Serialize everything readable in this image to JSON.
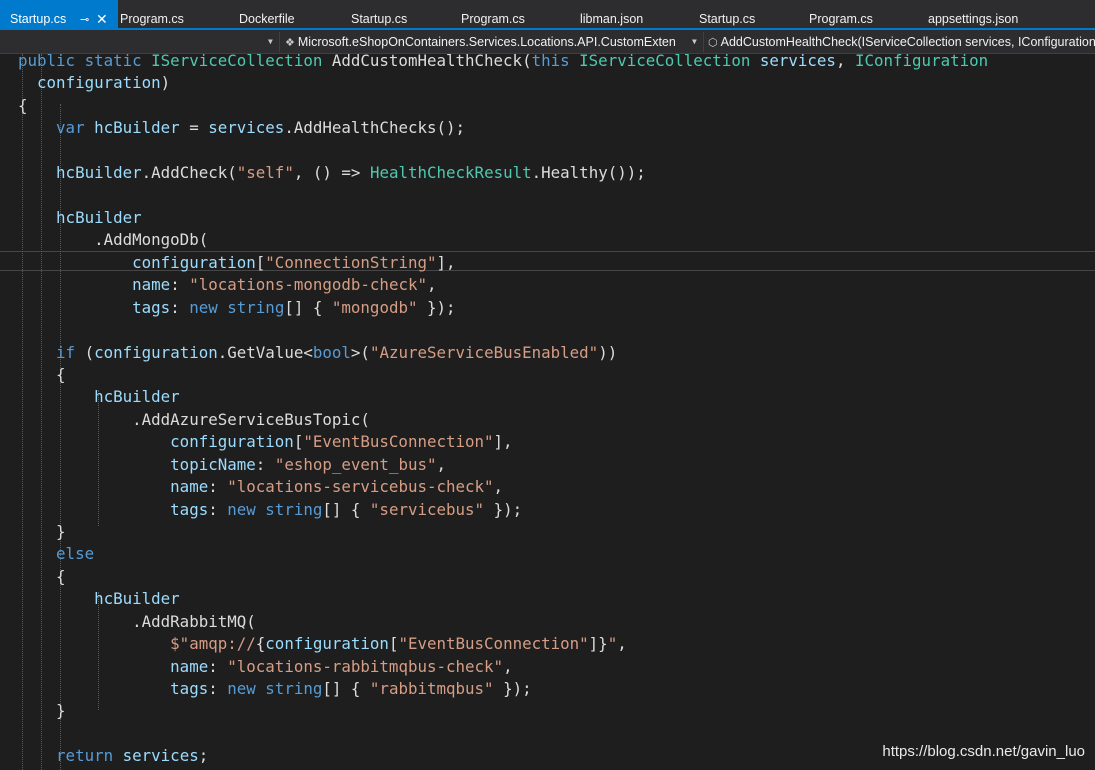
{
  "tabs": [
    {
      "label": "Startup.cs",
      "active": true
    },
    {
      "label": "Program.cs"
    },
    {
      "label": "Dockerfile"
    },
    {
      "label": "Startup.cs"
    },
    {
      "label": "Program.cs"
    },
    {
      "label": "libman.json"
    },
    {
      "label": "Startup.cs"
    },
    {
      "label": "Program.cs"
    },
    {
      "label": "appsettings.json"
    }
  ],
  "tab_icons": {
    "pin": "pin-icon",
    "close": "close-icon"
  },
  "navbar": {
    "type_selector": "Microsoft.eShopOnContainers.Services.Locations.API.CustomExten",
    "member_selector": "AddCustomHealthCheck(IServiceCollection services, IConfiguration"
  },
  "code": [
    [
      [
        "kw",
        "public static "
      ],
      [
        "ty",
        "IServiceCollection "
      ],
      [
        "pl",
        "AddCustomHealthCheck("
      ],
      [
        "kw",
        "this "
      ],
      [
        "ty",
        "IServiceCollection "
      ],
      [
        "id",
        "services"
      ],
      [
        "pl",
        ", "
      ],
      [
        "ty",
        "IConfiguration"
      ]
    ],
    [
      [
        "pl",
        "  "
      ],
      [
        "id",
        "configuration"
      ],
      [
        "pl",
        ")"
      ]
    ],
    [
      [
        "pl",
        "{"
      ]
    ],
    [
      [
        "pl",
        "    "
      ],
      [
        "kw",
        "var "
      ],
      [
        "id",
        "hcBuilder "
      ],
      [
        "pl",
        "= "
      ],
      [
        "id",
        "services"
      ],
      [
        "pl",
        ".AddHealthChecks();"
      ]
    ],
    [
      [
        "pl",
        ""
      ]
    ],
    [
      [
        "pl",
        "    "
      ],
      [
        "id",
        "hcBuilder"
      ],
      [
        "pl",
        ".AddCheck("
      ],
      [
        "str",
        "\"self\""
      ],
      [
        "pl",
        ", () => "
      ],
      [
        "ty",
        "HealthCheckResult"
      ],
      [
        "pl",
        ".Healthy());"
      ]
    ],
    [
      [
        "pl",
        ""
      ]
    ],
    [
      [
        "pl",
        "    "
      ],
      [
        "id",
        "hcBuilder"
      ]
    ],
    [
      [
        "pl",
        "        .AddMongoDb("
      ]
    ],
    [
      [
        "pl",
        "            "
      ],
      [
        "id",
        "configuration"
      ],
      [
        "pl",
        "["
      ],
      [
        "str",
        "\"ConnectionString\""
      ],
      [
        "pl",
        "],"
      ]
    ],
    [
      [
        "pl",
        "            "
      ],
      [
        "id",
        "name"
      ],
      [
        "pl",
        ": "
      ],
      [
        "str",
        "\"locations-mongodb-check\""
      ],
      [
        "pl",
        ","
      ]
    ],
    [
      [
        "pl",
        "            "
      ],
      [
        "id",
        "tags"
      ],
      [
        "pl",
        ": "
      ],
      [
        "kw",
        "new string"
      ],
      [
        "pl",
        "[] { "
      ],
      [
        "str",
        "\"mongodb\""
      ],
      [
        "pl",
        " });"
      ]
    ],
    [
      [
        "pl",
        ""
      ]
    ],
    [
      [
        "pl",
        "    "
      ],
      [
        "kw",
        "if "
      ],
      [
        "pl",
        "("
      ],
      [
        "id",
        "configuration"
      ],
      [
        "pl",
        ".GetValue<"
      ],
      [
        "kw",
        "bool"
      ],
      [
        "pl",
        ">("
      ],
      [
        "str",
        "\"AzureServiceBusEnabled\""
      ],
      [
        "pl",
        "))"
      ]
    ],
    [
      [
        "pl",
        "    {"
      ]
    ],
    [
      [
        "pl",
        "        "
      ],
      [
        "id",
        "hcBuilder"
      ]
    ],
    [
      [
        "pl",
        "            .AddAzureServiceBusTopic("
      ]
    ],
    [
      [
        "pl",
        "                "
      ],
      [
        "id",
        "configuration"
      ],
      [
        "pl",
        "["
      ],
      [
        "str",
        "\"EventBusConnection\""
      ],
      [
        "pl",
        "],"
      ]
    ],
    [
      [
        "pl",
        "                "
      ],
      [
        "id",
        "topicName"
      ],
      [
        "pl",
        ": "
      ],
      [
        "str",
        "\"eshop_event_bus\""
      ],
      [
        "pl",
        ","
      ]
    ],
    [
      [
        "pl",
        "                "
      ],
      [
        "id",
        "name"
      ],
      [
        "pl",
        ": "
      ],
      [
        "str",
        "\"locations-servicebus-check\""
      ],
      [
        "pl",
        ","
      ]
    ],
    [
      [
        "pl",
        "                "
      ],
      [
        "id",
        "tags"
      ],
      [
        "pl",
        ": "
      ],
      [
        "kw",
        "new string"
      ],
      [
        "pl",
        "[] { "
      ],
      [
        "str",
        "\"servicebus\""
      ],
      [
        "pl",
        " });"
      ]
    ],
    [
      [
        "pl",
        "    }"
      ]
    ],
    [
      [
        "pl",
        "    "
      ],
      [
        "kw",
        "else"
      ]
    ],
    [
      [
        "pl",
        "    {"
      ]
    ],
    [
      [
        "pl",
        "        "
      ],
      [
        "id",
        "hcBuilder"
      ]
    ],
    [
      [
        "pl",
        "            .AddRabbitMQ("
      ]
    ],
    [
      [
        "pl",
        "                "
      ],
      [
        "str",
        "$\"amqp://"
      ],
      [
        "pl",
        "{"
      ],
      [
        "id",
        "configuration"
      ],
      [
        "pl",
        "["
      ],
      [
        "str",
        "\"EventBusConnection\""
      ],
      [
        "pl",
        "]}"
      ],
      [
        "str",
        "\""
      ],
      [
        "pl",
        ","
      ]
    ],
    [
      [
        "pl",
        "                "
      ],
      [
        "id",
        "name"
      ],
      [
        "pl",
        ": "
      ],
      [
        "str",
        "\"locations-rabbitmqbus-check\""
      ],
      [
        "pl",
        ","
      ]
    ],
    [
      [
        "pl",
        "                "
      ],
      [
        "id",
        "tags"
      ],
      [
        "pl",
        ": "
      ],
      [
        "kw",
        "new string"
      ],
      [
        "pl",
        "[] { "
      ],
      [
        "str",
        "\"rabbitmqbus\""
      ],
      [
        "pl",
        " });"
      ]
    ],
    [
      [
        "pl",
        "    }"
      ]
    ],
    [
      [
        "pl",
        ""
      ]
    ],
    [
      [
        "pl",
        "    "
      ],
      [
        "kw",
        "return "
      ],
      [
        "id",
        "services"
      ],
      [
        "pl",
        ";"
      ]
    ]
  ],
  "watermark": "https://blog.csdn.net/gavin_luo"
}
